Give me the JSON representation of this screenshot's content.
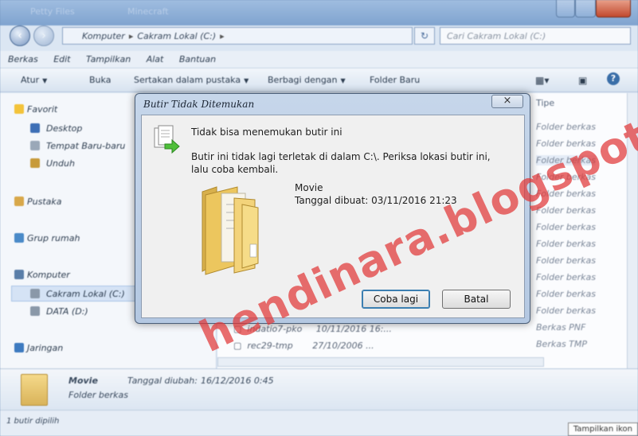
{
  "explorer": {
    "title_ghost_left": "Petty Files",
    "title_ghost_right": "Minecraft",
    "breadcrumb": [
      "Komputer",
      "Cakram Lokal (C:)"
    ],
    "search_placeholder": "Cari Cakram Lokal (C:)",
    "menu": [
      "Berkas",
      "Edit",
      "Tampilkan",
      "Alat",
      "Bantuan"
    ],
    "toolbar": {
      "organize": "Atur",
      "open": "Buka",
      "include_library": "Sertakan dalam pustaka",
      "share_with": "Berbagi dengan",
      "new_folder": "Folder Baru"
    },
    "sidebar": {
      "favorites": "Favorit",
      "desktop": "Desktop",
      "recent_places": "Tempat Baru-baru",
      "downloads": "Unduh",
      "libraries": "Pustaka",
      "homegroup": "Grup rumah",
      "computer": "Komputer",
      "local_disk": "Cakram Lokal (C:)",
      "data_drive": "DATA (D:)",
      "network": "Jaringan"
    },
    "column_type": "Tipe",
    "column_date_hint": "Tanggal diubah",
    "row_types": [
      "Folder berkas",
      "Folder berkas",
      "Folder berkas",
      "Folder berkas",
      "Folder berkas",
      "Folder berkas",
      "Folder berkas",
      "Folder berkas",
      "Folder berkas",
      "Folder berkas",
      "Folder berkas",
      "Folder berkas",
      "Berkas",
      "Berkas PNF",
      "Berkas TMP"
    ],
    "files": [
      {
        "name": "indatio7-pko",
        "date": "10/11/2016 16:..."
      },
      {
        "name": "rec29-tmp",
        "date": "27/10/2006 ..."
      }
    ],
    "details": {
      "name": "Movie",
      "type": "Folder berkas",
      "modified_label": "Tanggal diubah:",
      "modified_value": "16/12/2016 0:45"
    },
    "status": "1 butir dipilih",
    "tooltip": "Tampilkan ikon"
  },
  "dialog": {
    "title": "Butir Tidak Ditemukan",
    "close_symbol": "×",
    "heading": "Tidak bisa menemukan butir ini",
    "message": "Butir ini tidak lagi terletak di dalam C:\\. Periksa lokasi butir ini, lalu coba kembali.",
    "item_name": "Movie",
    "item_date": "Tanggal dibuat: 03/11/2016 21:23",
    "retry_label": "Coba lagi",
    "cancel_label": "Batal"
  },
  "watermark": "hendinara.blogspot.com",
  "colors": {
    "accent": "#3c7fb1",
    "watermark": "#e13737",
    "dialog_frame": "#b4c8e2"
  }
}
